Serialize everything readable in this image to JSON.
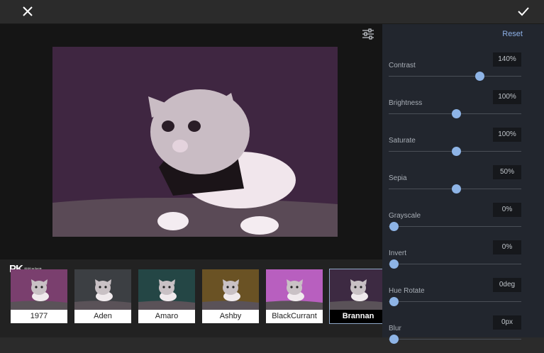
{
  "toolbar": {
    "close_icon": "close-icon",
    "confirm_icon": "checkmark-icon"
  },
  "editor": {
    "adjust_icon": "sliders-icon"
  },
  "logo": {
    "text": "PK",
    "subtext": "電腦王阿達"
  },
  "filters": [
    {
      "name": "1977",
      "tint": "#7a3f6e",
      "active": false
    },
    {
      "name": "Aden",
      "tint": "#3c3f43",
      "active": false
    },
    {
      "name": "Amaro",
      "tint": "#244645",
      "active": false
    },
    {
      "name": "Ashby",
      "tint": "#6a5224",
      "active": false
    },
    {
      "name": "BlackCurrant",
      "tint": "#b85fbf",
      "active": false
    },
    {
      "name": "Brannan",
      "tint": "#3d2a42",
      "active": true
    }
  ],
  "panel": {
    "reset_label": "Reset",
    "controls": [
      {
        "label": "Contrast",
        "value": "140%",
        "level": 0.67
      },
      {
        "label": "Brightness",
        "value": "100%",
        "level": 0.49
      },
      {
        "label": "Saturate",
        "value": "100%",
        "level": 0.49
      },
      {
        "label": "Sepia",
        "value": "50%",
        "level": 0.49
      },
      {
        "label": "Grayscale",
        "value": "0%",
        "level": 0.0
      },
      {
        "label": "Invert",
        "value": "0%",
        "level": 0.0
      },
      {
        "label": "Hue Rotate",
        "value": "0deg",
        "level": 0.0
      },
      {
        "label": "Blur",
        "value": "0px",
        "level": 0.0
      }
    ]
  },
  "colors": {
    "accent": "#8eb4e6",
    "photo_bg": "#3f2641"
  }
}
